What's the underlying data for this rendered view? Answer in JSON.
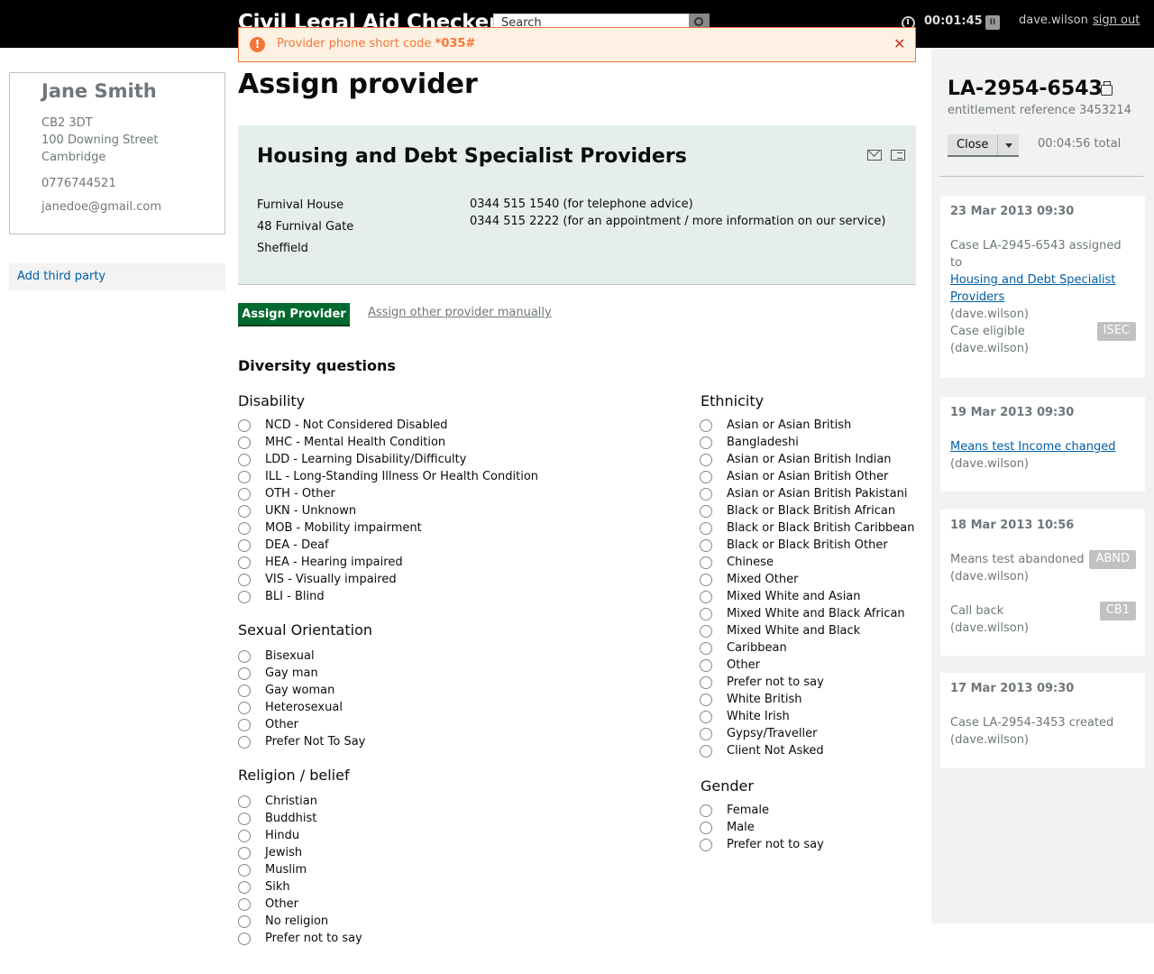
{
  "header": {
    "app_title": "Civil Legal Aid Checker",
    "search_placeholder": "Search",
    "timer": "00:01:45",
    "username": "dave.wilson",
    "signout": "sign out"
  },
  "alert": {
    "text": "Provider phone short code",
    "code": "*035#"
  },
  "person": {
    "name": "Jane Smith",
    "postcode": "CB2 3DT",
    "street": "100 Downing Street",
    "city": "Cambridge",
    "phone": "0776744521",
    "email": "janedoe@gmail.com"
  },
  "left_nav": {
    "add_third_party": "Add third party"
  },
  "main": {
    "title": "Assign provider",
    "provider": {
      "name": "Housing and Debt Specialist Providers",
      "address": [
        "Furnival House",
        "48 Furnival Gate",
        "Sheffield"
      ],
      "phones": [
        "0344 515 1540 (for telephone advice)",
        "0344 515 2222 (for an appointment / more information on our service)"
      ]
    },
    "assign_button": "Assign Provider",
    "assign_other": "Assign other provider manually",
    "diversity_heading": "Diversity questions",
    "disability": {
      "title": "Disability",
      "options": [
        "NCD - Not Considered Disabled",
        "MHC - Mental Health Condition",
        "LDD - Learning Disability/Difficulty",
        "ILL - Long-Standing Illness Or Health Condition",
        "OTH - Other",
        "UKN - Unknown",
        "MOB - Mobility impairment",
        "DEA - Deaf",
        "HEA - Hearing impaired",
        "VIS - Visually impaired",
        "BLI - Blind"
      ]
    },
    "sexual_orientation": {
      "title": "Sexual Orientation",
      "options": [
        "Bisexual",
        "Gay man",
        "Gay woman",
        "Heterosexual",
        "Other",
        "Prefer Not To Say"
      ]
    },
    "religion": {
      "title": "Religion / belief",
      "options": [
        "Christian",
        "Buddhist",
        "Hindu",
        "Jewish",
        "Muslim",
        "Sikh",
        "Other",
        "No religion",
        "Prefer not to say"
      ]
    },
    "ethnicity": {
      "title": "Ethnicity",
      "options": [
        "Asian or Asian British",
        "Bangladeshi",
        "Asian or Asian British Indian",
        "Asian or Asian British Other",
        "Asian or Asian British Pakistani",
        "Black or Black British African",
        "Black or Black British Caribbean",
        "Black or Black British Other",
        "Chinese",
        "Mixed Other",
        "Mixed White and Asian",
        "Mixed White and Black African",
        "Mixed White and Black",
        "Caribbean",
        "Other",
        "Prefer not to say",
        "White British",
        "White Irish",
        "Gypsy/Traveller",
        "Client Not Asked"
      ]
    },
    "gender": {
      "title": "Gender",
      "options": [
        "Female",
        "Male",
        "Prefer not to say"
      ]
    }
  },
  "sidebar": {
    "case_ref": "LA-2954-6543",
    "entitlement": "entitlement reference 3453214",
    "close_label": "Close",
    "total_time": "00:04:56 total",
    "log": [
      {
        "date": "23 Mar 2013 09:30",
        "assigned_prefix": "Case LA-2945-6543 assigned to",
        "assigned_link": "Housing and Debt Specialist Providers",
        "assigned_user": "(dave.wilson)",
        "eligible": "Case eligible",
        "eligible_user": "(dave.wilson)",
        "eligible_badge": "ISEC"
      },
      {
        "date": "19 Mar 2013 09:30",
        "link": "Means test Income changed",
        "user": "(dave.wilson)"
      },
      {
        "date": "18 Mar 2013 10:56",
        "abandoned": "Means test abandoned",
        "abandoned_user": "(dave.wilson)",
        "abandoned_badge": "ABND",
        "callback": "Call back",
        "callback_user": "(dave.wilson)",
        "callback_badge": "CB1"
      },
      {
        "date": "17 Mar 2013 09:30",
        "created": "Case LA-2954-3453 created",
        "user": "(dave.wilson)"
      }
    ]
  }
}
